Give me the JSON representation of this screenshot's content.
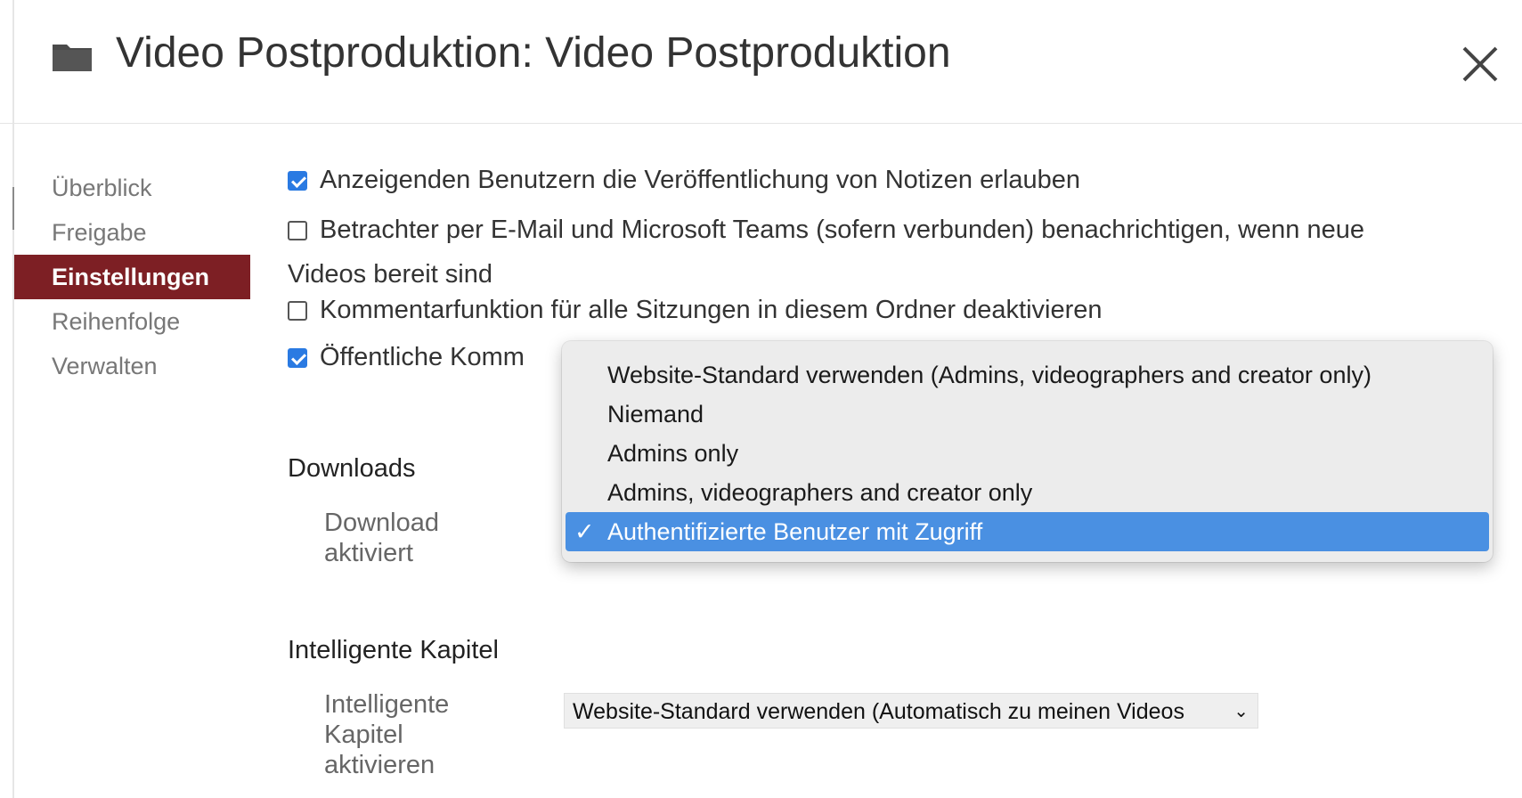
{
  "header": {
    "title": "Video Postproduktion: Video Postproduktion"
  },
  "sidebar": {
    "items": [
      {
        "label": "Überblick"
      },
      {
        "label": "Freigabe"
      },
      {
        "label": "Einstellungen",
        "active": true
      },
      {
        "label": "Reihenfolge"
      },
      {
        "label": "Verwalten"
      }
    ]
  },
  "settings": {
    "notes_label": "Anzeigenden Benutzern die Veröffentlichung von Notizen erlauben",
    "notes_checked": true,
    "notify_label_line1": "Betrachter per E-Mail und Microsoft Teams (sofern verbunden) benachrichtigen, wenn neue",
    "notify_label_line2": "Videos bereit sind",
    "notify_checked": false,
    "comments_disable_label": "Kommentarfunktion für alle Sitzungen in diesem Ordner deaktivieren",
    "comments_disable_checked": false,
    "public_comments_label": "Öffentliche Komm",
    "public_comments_checked": true
  },
  "downloads": {
    "section_title": "Downloads",
    "field_label_line1": "Download",
    "field_label_line2": "aktiviert"
  },
  "dropdown": {
    "options": [
      {
        "label": "Website-Standard verwenden (Admins, videographers and creator only)"
      },
      {
        "label": "Niemand"
      },
      {
        "label": "Admins only"
      },
      {
        "label": "Admins, videographers and creator only"
      },
      {
        "label": "Authentifizierte Benutzer mit Zugriff",
        "selected": true
      }
    ],
    "check_glyph": "✓"
  },
  "smart_chapters": {
    "section_title": "Intelligente Kapitel",
    "field_label_line1": "Intelligente",
    "field_label_line2": "Kapitel",
    "field_label_line3": "aktivieren",
    "select_value": "Website-Standard verwenden (Automatisch zu meinen Videos",
    "chevron": "⌄"
  },
  "colors": {
    "accent": "#7d1f24",
    "checkbox": "#2a7ae2",
    "selection": "#4a90e2"
  },
  "icons": {
    "folder": "folder-icon",
    "close": "close-icon",
    "checkmark": "checkmark-icon"
  }
}
